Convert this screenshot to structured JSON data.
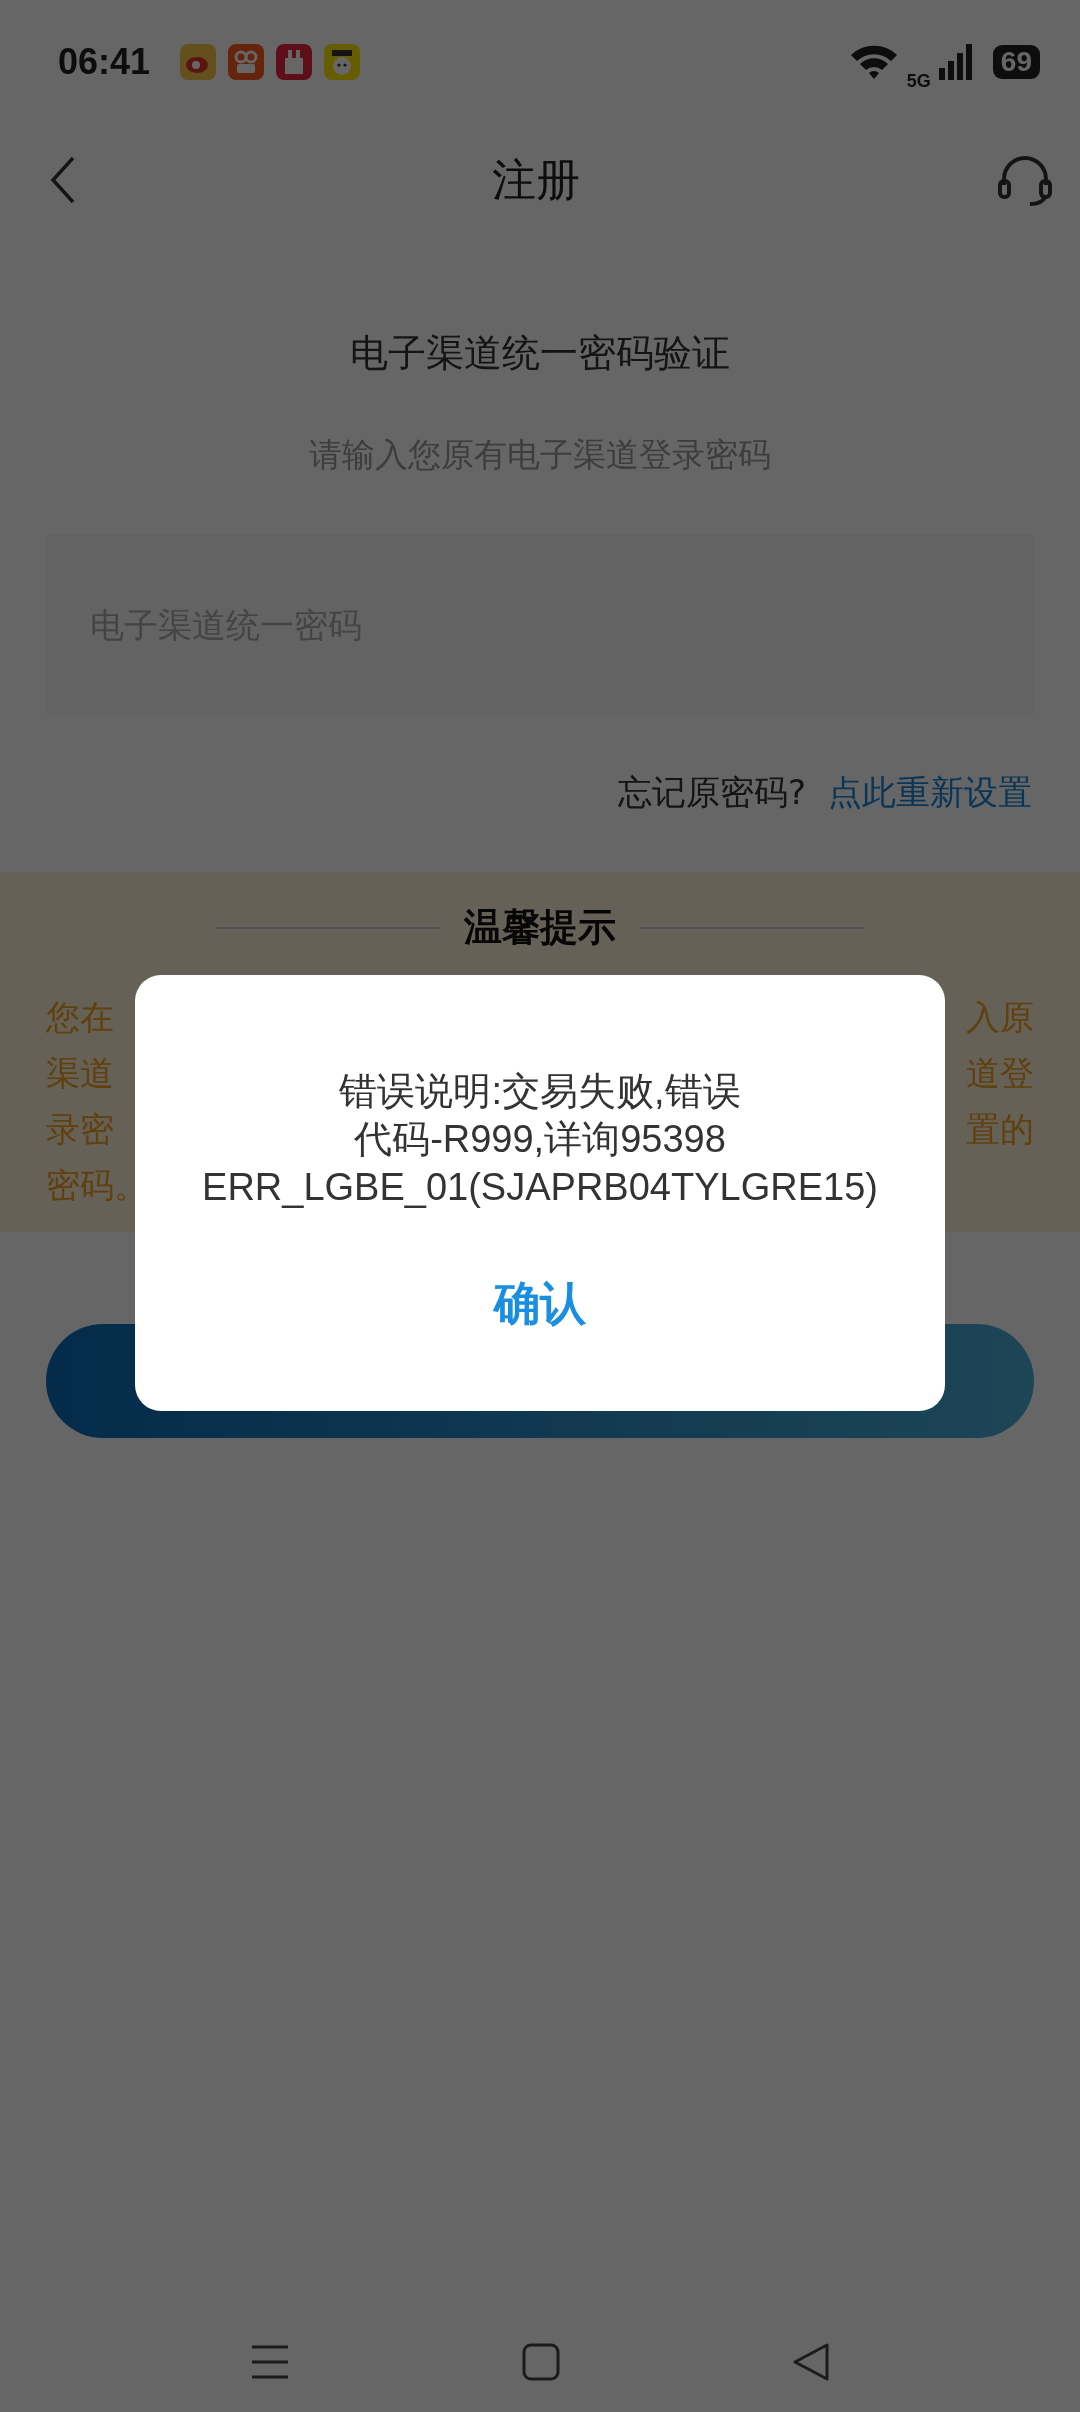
{
  "status_bar": {
    "time": "06:41",
    "network": "5G",
    "battery": "69"
  },
  "header": {
    "title": "注册"
  },
  "heading": "电子渠道统一密码验证",
  "subtitle": "请输入您原有电子渠道登录密码",
  "password_field": {
    "placeholder": "电子渠道统一密码"
  },
  "forgot": {
    "text": "忘记原密码?",
    "link": "点此重新设置"
  },
  "tips": {
    "title": "温馨提示",
    "lines": [
      {
        "left": "您在",
        "right": "入原"
      },
      {
        "left": "渠道",
        "right": "道登"
      },
      {
        "left": "录密",
        "right": "置的"
      },
      {
        "left": "密码。"
      }
    ]
  },
  "dialog": {
    "lines": [
      "错误说明:交易失败,错误",
      "代码-R999,详询95398",
      "ERR_LGBE_01(SJAPRB04TYLGRE15)"
    ],
    "button": "确认"
  }
}
